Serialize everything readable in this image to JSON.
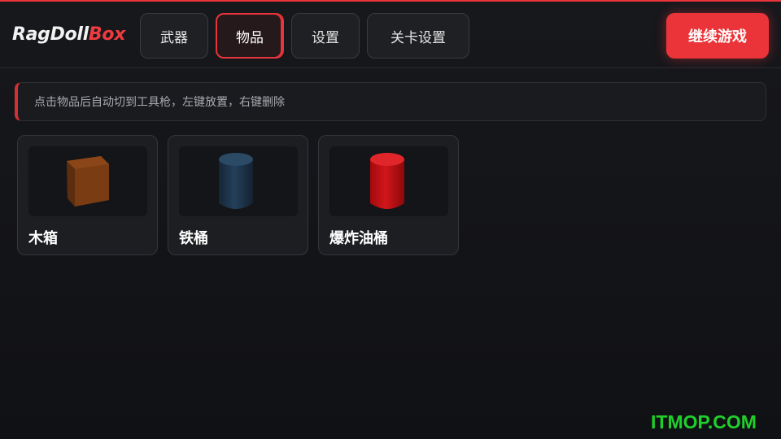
{
  "header": {
    "logo_main": "RagDoll",
    "logo_accent": "Box",
    "tabs": [
      {
        "label": "武器",
        "active": false
      },
      {
        "label": "物品",
        "active": true
      },
      {
        "label": "设置",
        "active": false
      },
      {
        "label": "关卡设置",
        "active": false
      }
    ],
    "continue_label": "继续游戏"
  },
  "hint": {
    "text": "点击物品后自动切到工具枪，左键放置，右键删除"
  },
  "items": [
    {
      "label": "木箱",
      "icon": "wooden-crate-icon",
      "color": "#7a3d12"
    },
    {
      "label": "铁桶",
      "icon": "iron-barrel-icon",
      "color": "#1d3347"
    },
    {
      "label": "爆炸油桶",
      "icon": "explosive-barrel-icon",
      "color": "#c40d12"
    }
  ],
  "watermark": "ITMOP.COM",
  "colors": {
    "accent": "#e8343a",
    "background": "#141518",
    "watermark": "#1fd02b"
  }
}
